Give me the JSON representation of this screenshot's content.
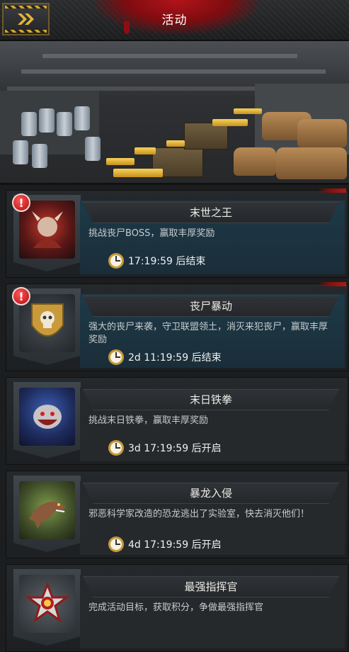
{
  "header": {
    "title": "活动",
    "back_icon": "chevron-double-right-icon",
    "accent": "#d6a62a"
  },
  "events": [
    {
      "name": "末世之王",
      "desc": "挑战丧尸BOSS，赢取丰厚奖励",
      "time": "17:19:59 后结束",
      "alert": "!",
      "active": true,
      "icon": "zombie-lord-portrait"
    },
    {
      "name": "丧尸暴动",
      "desc": "强大的丧尸来袭，守卫联盟领土，消灭来犯丧尸，赢取丰厚奖励",
      "time": "2d 11:19:59 后结束",
      "alert": "!",
      "active": true,
      "icon": "skull-shield-emblem"
    },
    {
      "name": "末日铁拳",
      "desc": "挑战末日铁拳，赢取丰厚奖励",
      "time": "3d 17:19:59 后开启",
      "alert": "",
      "active": false,
      "icon": "mutant-beast-portrait"
    },
    {
      "name": "暴龙入侵",
      "desc": "邪恶科学家改造的恐龙逃出了实验室，快去消灭他们！",
      "time": "4d 17:19:59 后开启",
      "alert": "",
      "active": false,
      "icon": "trex-portrait"
    },
    {
      "name": "最强指挥官",
      "desc": "完成活动目标，获取积分，争做最强指挥官",
      "time": "",
      "alert": "",
      "active": false,
      "icon": "commander-medal-emblem"
    }
  ],
  "colors": {
    "active_body": "#1e3948",
    "alert_red": "#d31717",
    "gold": "#f6d35a"
  }
}
